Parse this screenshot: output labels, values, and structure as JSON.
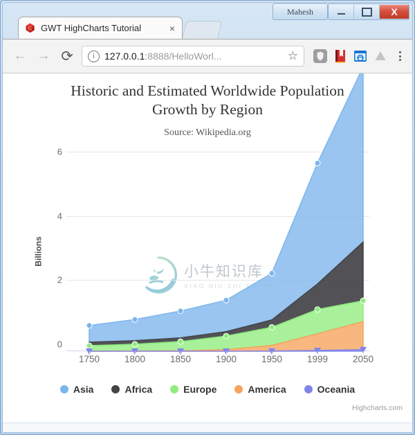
{
  "window": {
    "user_button": "Mahesh",
    "minimize": "–",
    "maximize": "□",
    "close": "X"
  },
  "tab": {
    "title": "GWT HighCharts Tutorial",
    "close": "×",
    "favicon": "gwt-logo-icon"
  },
  "toolbar": {
    "back": "←",
    "forward": "→",
    "reload": "⟳",
    "info": "ⓘ",
    "url_host": "127.0.0.1",
    "url_rest": ":8888/HelloWorl...",
    "bookmark_star": "☆",
    "extensions": [
      "shield-icon",
      "red-book-icon",
      "blue-photo-icon",
      "drive-icon"
    ],
    "menu": "chrome-menu-icon"
  },
  "chart_data": {
    "type": "area",
    "title": "Historic and Estimated Worldwide Population Growth by Region",
    "title_line1": "Historic and Estimated Worldwide Population",
    "title_line2": "Growth by Region",
    "subtitle": "Source: Wikipedia.org",
    "xlabel": "",
    "ylabel": "Billions",
    "categories": [
      "1750",
      "1800",
      "1850",
      "1900",
      "1950",
      "1999",
      "2050"
    ],
    "yticks": [
      "0",
      "2",
      "4",
      "6"
    ],
    "ylim": [
      0,
      6
    ],
    "stacking": "normal",
    "grid": true,
    "legend_position": "bottom",
    "credits": "Highcharts.com",
    "series": [
      {
        "name": "Asia",
        "color": "#7cb5ec",
        "values": [
          0.502,
          0.635,
          0.809,
          0.947,
          1.402,
          3.634,
          5.268
        ]
      },
      {
        "name": "Africa",
        "color": "#434348",
        "values": [
          0.106,
          0.107,
          0.111,
          0.133,
          0.221,
          0.767,
          1.766
        ]
      },
      {
        "name": "Europe",
        "color": "#90ed7d",
        "values": [
          0.163,
          0.203,
          0.276,
          0.408,
          0.547,
          0.729,
          0.628
        ]
      },
      {
        "name": "America",
        "color": "#f7a35c",
        "values": [
          0.002,
          0.007,
          0.013,
          0.046,
          0.17,
          0.504,
          0.843
        ]
      },
      {
        "name": "Oceania",
        "color": "#8085e9",
        "values": [
          0.0,
          0.0,
          0.0,
          0.0,
          0.003,
          0.022,
          0.046
        ]
      }
    ]
  },
  "watermark": {
    "cn": "小牛知识库",
    "en": "XIAO NIU ZHI SHI KU"
  }
}
